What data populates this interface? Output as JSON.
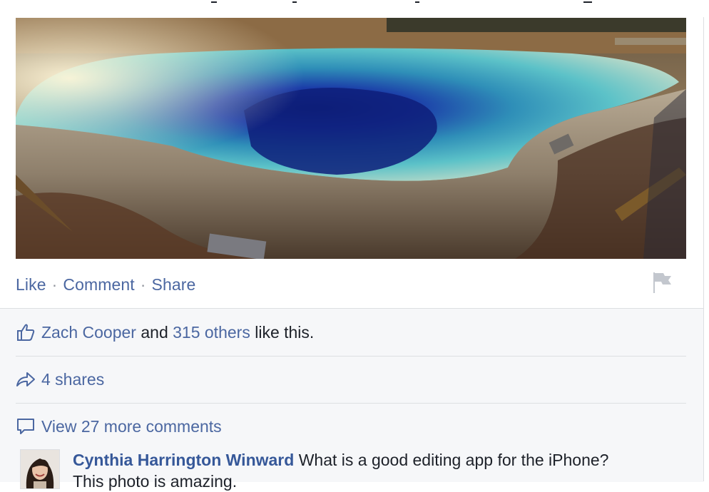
{
  "post": {
    "photo_alt": "",
    "actions": {
      "like": "Like",
      "comment": "Comment",
      "share": "Share",
      "separator": "·"
    },
    "flag_icon": "flag-icon"
  },
  "ufi": {
    "likes": {
      "icon": "thumbs-up-icon",
      "first_name": "Zach Cooper",
      "conjunction": "and",
      "others": "315 others",
      "suffix": "like this."
    },
    "shares": {
      "icon": "share-arrow-icon",
      "label": "4 shares"
    },
    "comments": {
      "icon": "speech-bubble-icon",
      "view_more": "View 27 more comments"
    },
    "comment": {
      "author": "Cynthia Harrington Winward",
      "text": "What is a good editing app for the iPhone?",
      "text_line2": "This photo is amazing."
    }
  },
  "colors": {
    "link": "#4b67a1",
    "author": "#365899",
    "text": "#1d2129",
    "ufi_bg": "#f6f7f9",
    "border": "#dddfe2"
  }
}
